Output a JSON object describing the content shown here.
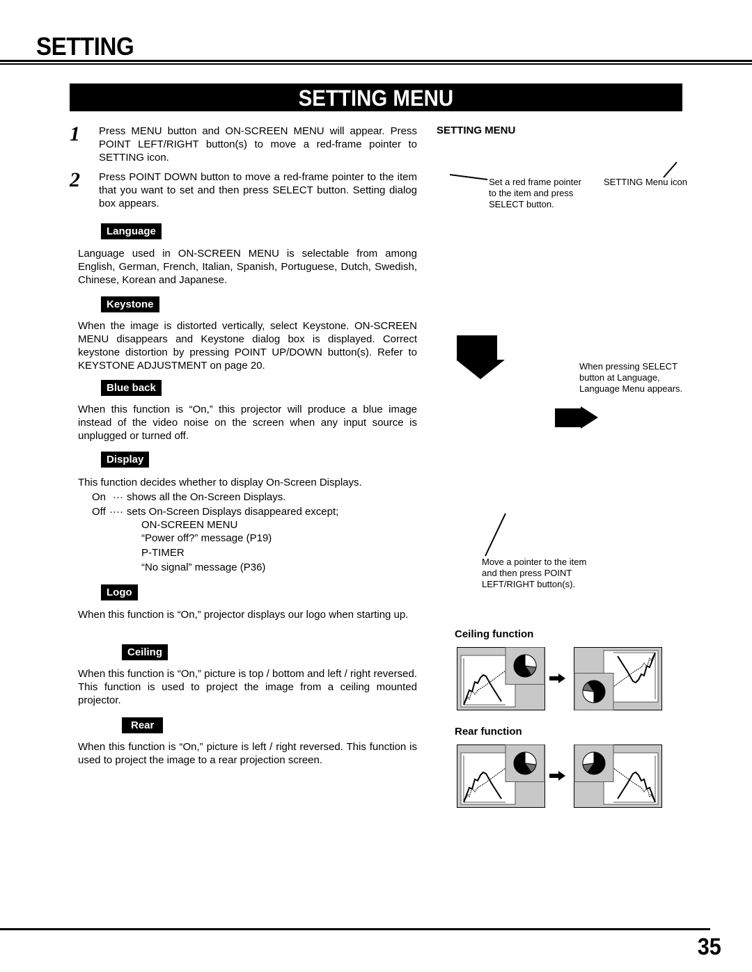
{
  "page": {
    "section_title": "SETTING",
    "banner_title": "SETTING MENU",
    "page_number": "35"
  },
  "steps": [
    {
      "number": "1",
      "text": "Press MENU button and ON-SCREEN MENU will appear.  Press POINT LEFT/RIGHT button(s) to move a red-frame pointer to SETTING icon."
    },
    {
      "number": "2",
      "text": "Press POINT DOWN button to move a red-frame pointer to the item that you want to set and then press SELECT button. Setting dialog box appears."
    }
  ],
  "items": {
    "language": {
      "label": "Language",
      "text": "Language used in ON-SCREEN MENU is selectable from among English, German, French, Italian, Spanish, Portuguese, Dutch, Swedish, Chinese, Korean and Japanese."
    },
    "keystone": {
      "label": "Keystone",
      "text": "When the image is distorted vertically, select Keystone.  ON-SCREEN MENU disappears and Keystone dialog box is displayed. Correct keystone distortion by pressing POINT UP/DOWN button(s). Refer to KEYSTONE ADJUSTMENT on page 20."
    },
    "blue_back": {
      "label": "Blue back",
      "text": "When this function is “On,” this projector will produce a blue image instead of the video noise on the screen when any input source is unplugged or turned off."
    },
    "display": {
      "label": "Display",
      "intro": "This function decides whether to display On-Screen Displays.",
      "on_key": "On",
      "on_dots": "···",
      "on_text": "shows all the On-Screen Displays.",
      "off_key": "Off",
      "off_dots": "····",
      "off_text": "sets On-Screen Displays disappeared except;",
      "exceptions": [
        "ON-SCREEN MENU",
        "“Power off?” message (P19)",
        "P-TIMER",
        "“No signal” message (P36)"
      ]
    },
    "logo": {
      "label": "Logo",
      "text": "When this function is “On,” projector displays our logo when starting up."
    },
    "ceiling": {
      "label": "Ceiling",
      "text": "When this function is “On,” picture is top / bottom and left / right reversed.  This function is used to project the image from a ceiling mounted projector."
    },
    "rear": {
      "label": "Rear",
      "text": "When this function is “On,” picture is left / right reversed.  This function is used to project the image to a rear projection screen."
    }
  },
  "figure": {
    "title": "SETTING MENU",
    "callouts": {
      "set_pointer": "Set a red frame pointer to the item and press SELECT button.",
      "menu_icon": "SETTING Menu icon",
      "select_language": "When pressing SELECT button at Language, Language Menu appears.",
      "move_pointer": "Move a pointer to the item and then press POINT LEFT/RIGHT button(s)."
    },
    "ceiling_title": "Ceiling function",
    "rear_title": "Rear function"
  },
  "colors": {
    "ink": "#000000",
    "paper": "#ffffff",
    "panel_gray": "#c8c8c8",
    "slice_gray": "#6e6e6e"
  }
}
